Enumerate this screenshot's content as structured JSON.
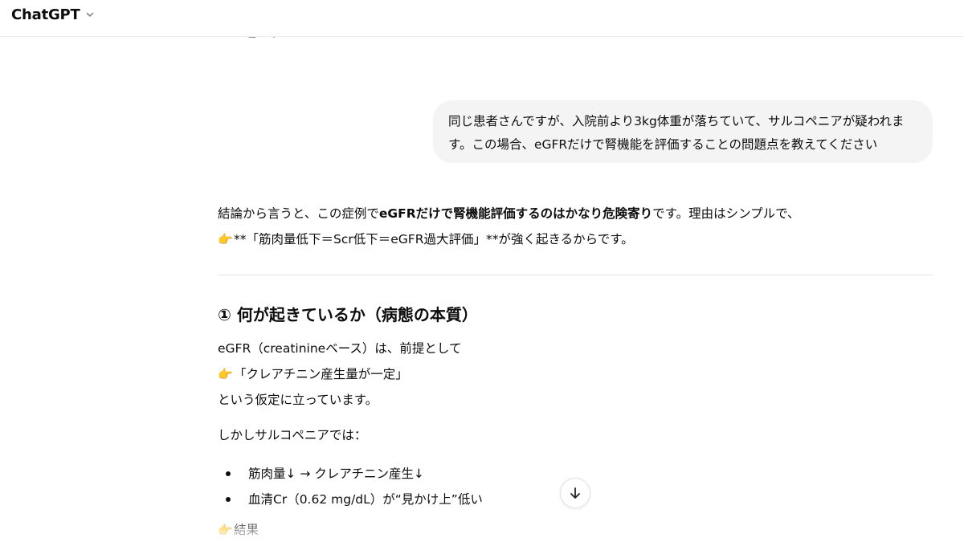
{
  "header": {
    "model_name": "ChatGPT",
    "model_chevron_icon": "chevron-down-icon"
  },
  "message_actions": {
    "icons": [
      "copy-icon",
      "branch-icon",
      "voice-icon",
      "share-icon",
      "regenerate-icon"
    ]
  },
  "user_message": {
    "line1": "同じ患者さんですが、入院前より3kg体重が落ちていて、サルコペニアが疑われま",
    "line2": "す。この場合、eGFRだけで腎機能を評価することの問題点を教えてください"
  },
  "assistant": {
    "intro_pre": "結論から言うと、この症例で",
    "intro_bold": "eGFRだけで腎機能評価するのはかなり危険寄り",
    "intro_post": "です。理由はシンプルで、",
    "point_emoji": "👉",
    "point_text": "**「筋肉量低下＝Scr低下＝eGFR過大評価」**が強く起きるからです。",
    "section1_heading": "① 何が起きているか（病態の本質）",
    "s1_line1": "eGFR（creatinineベース）は、前提として",
    "s1_line2": "「クレアチニン産生量が一定」",
    "s1_line3": "という仮定に立っています。",
    "s1_line4": "しかしサルコペニアでは：",
    "bullets": [
      "筋肉量↓ → クレアチニン産生↓",
      "血清Cr（0.62 mg/dL）が“見かけ上”低い"
    ],
    "result_label": "結果"
  },
  "scroll_button": {
    "icon": "arrow-down-icon"
  },
  "colors": {
    "bubble_bg": "#f4f4f4",
    "text": "#0d0d0d",
    "divider": "#e3e3e3",
    "emoji_accent": "#e8a317"
  }
}
